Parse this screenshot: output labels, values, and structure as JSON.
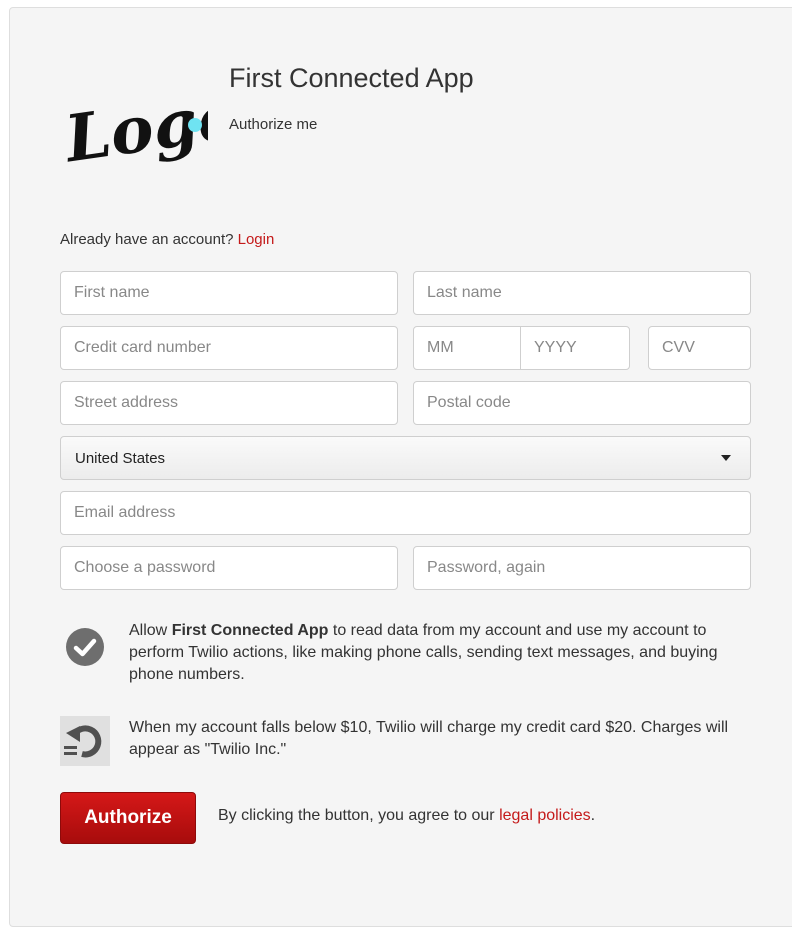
{
  "app": {
    "title": "First Connected App",
    "subtitle": "Authorize me",
    "logo_text": "Logo",
    "logo_dot_color": "#6fe3f2"
  },
  "account": {
    "prompt": "Already have an account?",
    "login_label": "Login"
  },
  "form": {
    "first_name": {
      "placeholder": "First name",
      "value": ""
    },
    "last_name": {
      "placeholder": "Last name",
      "value": ""
    },
    "card_number": {
      "placeholder": "Credit card number",
      "value": ""
    },
    "exp_month": {
      "placeholder": "MM",
      "value": ""
    },
    "exp_year": {
      "placeholder": "YYYY",
      "value": ""
    },
    "cvv": {
      "placeholder": "CVV",
      "value": ""
    },
    "street": {
      "placeholder": "Street address",
      "value": ""
    },
    "postal": {
      "placeholder": "Postal code",
      "value": ""
    },
    "country": {
      "selected": "United States"
    },
    "email": {
      "placeholder": "Email address",
      "value": ""
    },
    "password": {
      "placeholder": "Choose a password",
      "value": ""
    },
    "password_again": {
      "placeholder": "Password, again",
      "value": ""
    }
  },
  "permissions": {
    "allow_prefix": "Allow ",
    "allow_app": "First Connected App",
    "allow_suffix": " to read data from my account and use my account to perform Twilio actions, like making phone calls, sending text messages, and buying phone numbers.",
    "icon": "check-circle-icon"
  },
  "billing": {
    "text": "When my account falls below $10, Twilio will charge my credit card $20. Charges will appear as \"Twilio Inc.\"",
    "icon": "recharge-undo-icon"
  },
  "actions": {
    "authorize_label": "Authorize",
    "agree_prefix": "By clicking the button, you agree to our ",
    "legal_link": "legal policies",
    "agree_suffix": "."
  },
  "colors": {
    "accent": "#c41a1a",
    "button": "#b80f0f",
    "panel": "#f5f5f5"
  }
}
